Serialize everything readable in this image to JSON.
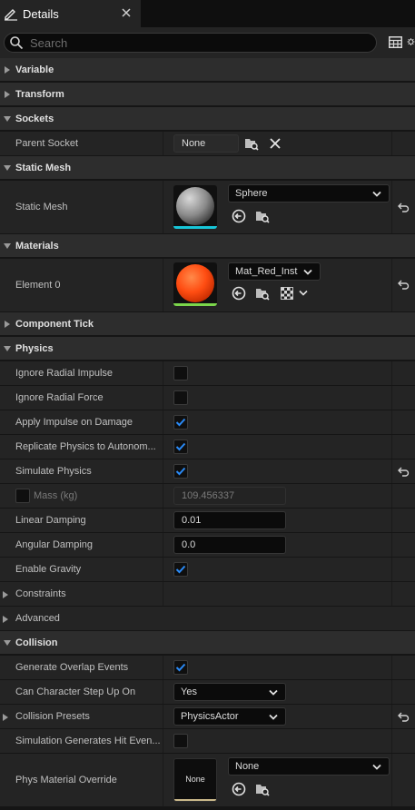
{
  "tab": {
    "title": "Details",
    "icon": "pencil-icon",
    "close": "close-icon"
  },
  "search": {
    "placeholder": "Search"
  },
  "categories": {
    "variable": "Variable",
    "transform": "Transform",
    "sockets": "Sockets",
    "static_mesh": "Static Mesh",
    "materials": "Materials",
    "component_tick": "Component Tick",
    "physics": "Physics",
    "constraints": "Constraints",
    "advanced": "Advanced",
    "collision": "Collision"
  },
  "sockets": {
    "parent_socket_label": "Parent Socket",
    "parent_socket_value": "None"
  },
  "static_mesh": {
    "label": "Static Mesh",
    "value": "Sphere"
  },
  "materials": {
    "label": "Element 0",
    "value": "Mat_Red_Inst"
  },
  "physics": {
    "ignore_radial_impulse": {
      "label": "Ignore Radial Impulse",
      "checked": false
    },
    "ignore_radial_force": {
      "label": "Ignore Radial Force",
      "checked": false
    },
    "apply_impulse_on_damage": {
      "label": "Apply Impulse on Damage",
      "checked": true
    },
    "replicate_physics": {
      "label": "Replicate Physics to Autonom...",
      "checked": true
    },
    "simulate_physics": {
      "label": "Simulate Physics",
      "checked": true
    },
    "mass": {
      "label": "Mass (kg)",
      "value": "109.456337",
      "override_checked": false
    },
    "linear_damping": {
      "label": "Linear Damping",
      "value": "0.01"
    },
    "angular_damping": {
      "label": "Angular Damping",
      "value": "0.0"
    },
    "enable_gravity": {
      "label": "Enable Gravity",
      "checked": true
    }
  },
  "collision": {
    "generate_overlap_events": {
      "label": "Generate Overlap Events",
      "checked": true
    },
    "can_step_up_on": {
      "label": "Can Character Step Up On",
      "value": "Yes"
    },
    "presets": {
      "label": "Collision Presets",
      "value": "PhysicsActor"
    },
    "sim_hit_events": {
      "label": "Simulation Generates Hit Even...",
      "checked": false
    },
    "phys_material_override": {
      "label": "Phys Material Override",
      "value": "None",
      "thumb_text": "None"
    }
  },
  "colors": {
    "accent": "#2a8af6",
    "panel": "#242424",
    "header": "#2d2d2d",
    "field": "#0b0b0b"
  }
}
